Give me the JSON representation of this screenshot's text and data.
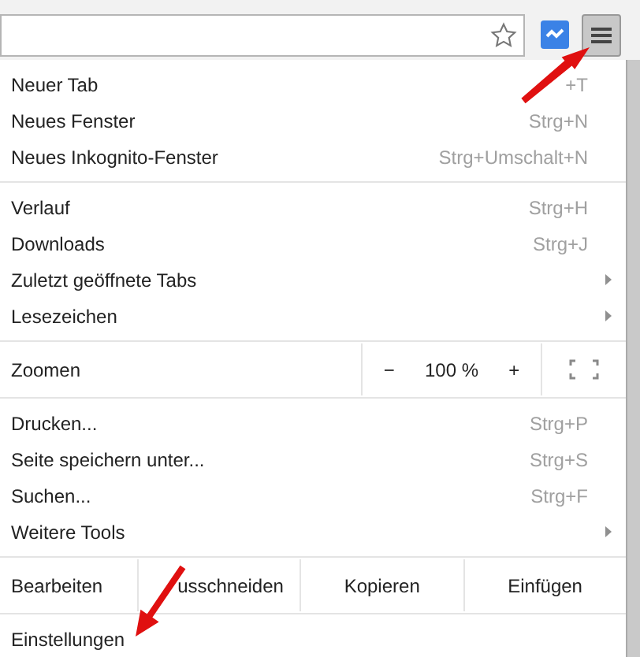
{
  "menu": {
    "sections": [
      {
        "items": [
          {
            "kind": "item",
            "label": "Neuer Tab",
            "shortcut": "+T"
          },
          {
            "kind": "item",
            "label": "Neues Fenster",
            "shortcut": "Strg+N"
          },
          {
            "kind": "item",
            "label": "Neues Inkognito-Fenster",
            "shortcut": "Strg+Umschalt+N"
          }
        ]
      },
      {
        "items": [
          {
            "kind": "item",
            "label": "Verlauf",
            "shortcut": "Strg+H"
          },
          {
            "kind": "item",
            "label": "Downloads",
            "shortcut": "Strg+J"
          },
          {
            "kind": "submenu",
            "label": "Zuletzt geöffnete Tabs"
          },
          {
            "kind": "submenu",
            "label": "Lesezeichen"
          }
        ]
      },
      {
        "items": [
          {
            "kind": "zoom",
            "label": "Zoomen",
            "minus": "−",
            "value": "100 %",
            "plus": "+"
          }
        ]
      },
      {
        "items": [
          {
            "kind": "item",
            "label": "Drucken...",
            "shortcut": "Strg+P"
          },
          {
            "kind": "item",
            "label": "Seite speichern unter...",
            "shortcut": "Strg+S"
          },
          {
            "kind": "item",
            "label": "Suchen...",
            "shortcut": "Strg+F"
          },
          {
            "kind": "submenu",
            "label": "Weitere Tools"
          }
        ]
      },
      {
        "items": [
          {
            "kind": "edit",
            "label": "Bearbeiten",
            "buttons": [
              "usschneiden",
              "Kopieren",
              "Einfügen"
            ]
          }
        ]
      },
      {
        "items": [
          {
            "kind": "item",
            "label": "Einstellungen"
          }
        ]
      }
    ]
  }
}
